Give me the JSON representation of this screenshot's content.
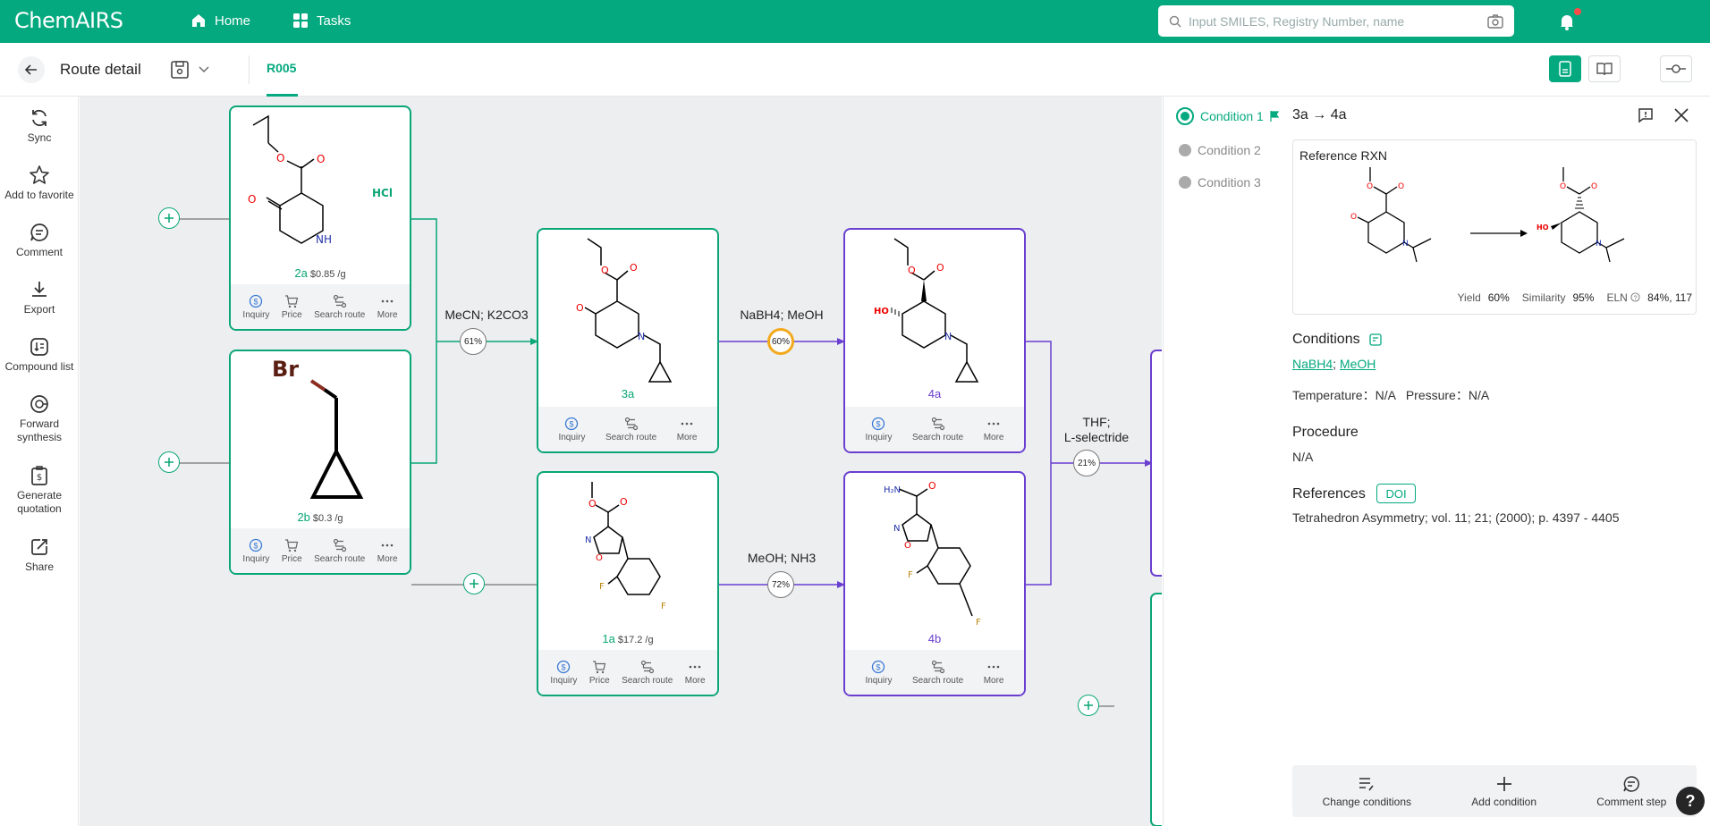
{
  "app": {
    "logo_text": "ChemAIRS"
  },
  "nav": {
    "home": "Home",
    "tasks": "Tasks"
  },
  "search": {
    "placeholder": "Input SMILES, Registry Number, name"
  },
  "subheader": {
    "title": "Route detail",
    "tab": "R005"
  },
  "sidebar": {
    "items": [
      {
        "label": "Sync",
        "icon": "sync-icon"
      },
      {
        "label": "Add to favorite",
        "icon": "star-icon"
      },
      {
        "label": "Comment",
        "icon": "comment-icon"
      },
      {
        "label": "Export",
        "icon": "download-icon"
      },
      {
        "label": "Compound list",
        "icon": "list-icon"
      },
      {
        "label": "Forward synthesis",
        "icon": "forward-icon"
      },
      {
        "label": "Generate quotation",
        "icon": "quote-icon"
      },
      {
        "label": "Share",
        "icon": "share-icon"
      }
    ]
  },
  "compounds": {
    "c2a": {
      "id": "2a",
      "price": "$0.85 /g",
      "salt": "HCl"
    },
    "c2b": {
      "id": "2b",
      "price": "$0.3 /g",
      "atom": "Br"
    },
    "c3a": {
      "id": "3a"
    },
    "c1a": {
      "id": "1a",
      "price": "$17.2 /g"
    },
    "c4a": {
      "id": "4a"
    },
    "c4b": {
      "id": "4b"
    }
  },
  "actions": {
    "inquiry": "Inquiry",
    "price": "Price",
    "search_route": "Search route",
    "more": "More"
  },
  "reactions": {
    "r1": {
      "label": "MeCN; K2CO3",
      "yield": "61%"
    },
    "r2": {
      "label": "NaBH4; MeOH",
      "yield": "60%"
    },
    "r3": {
      "label": "MeOH; NH3",
      "yield": "72%"
    },
    "r4": {
      "label_line1": "THF;",
      "label_line2": "L-selectride",
      "yield": "21%"
    }
  },
  "panel": {
    "conditions": [
      "Condition 1",
      "Condition 2",
      "Condition 3"
    ],
    "title": "3a → 4a",
    "reference_rxn": "Reference RXN",
    "yield_label": "Yield",
    "yield_value": "60%",
    "similarity_label": "Similarity",
    "similarity_value": "95%",
    "eln_label": "ELN",
    "eln_value": "84%, 117",
    "conditions_title": "Conditions",
    "reagent1": "NaBH4",
    "reagent2": "MeOH",
    "temp_pressure": "Temperature：N/A   Pressure：N/A",
    "procedure_title": "Procedure",
    "procedure_text": "N/A",
    "references_title": "References",
    "doi": "DOI",
    "reference_text": "Tetrahedron Asymmetry; vol. 11; 21; (2000); p. 4397 - 4405",
    "btn_change": "Change conditions",
    "btn_add": "Add condition",
    "btn_comment": "Comment step"
  },
  "colors": {
    "brand": "#04a97f",
    "purple": "#6a3fd0",
    "highlight": "#f2a91c"
  }
}
